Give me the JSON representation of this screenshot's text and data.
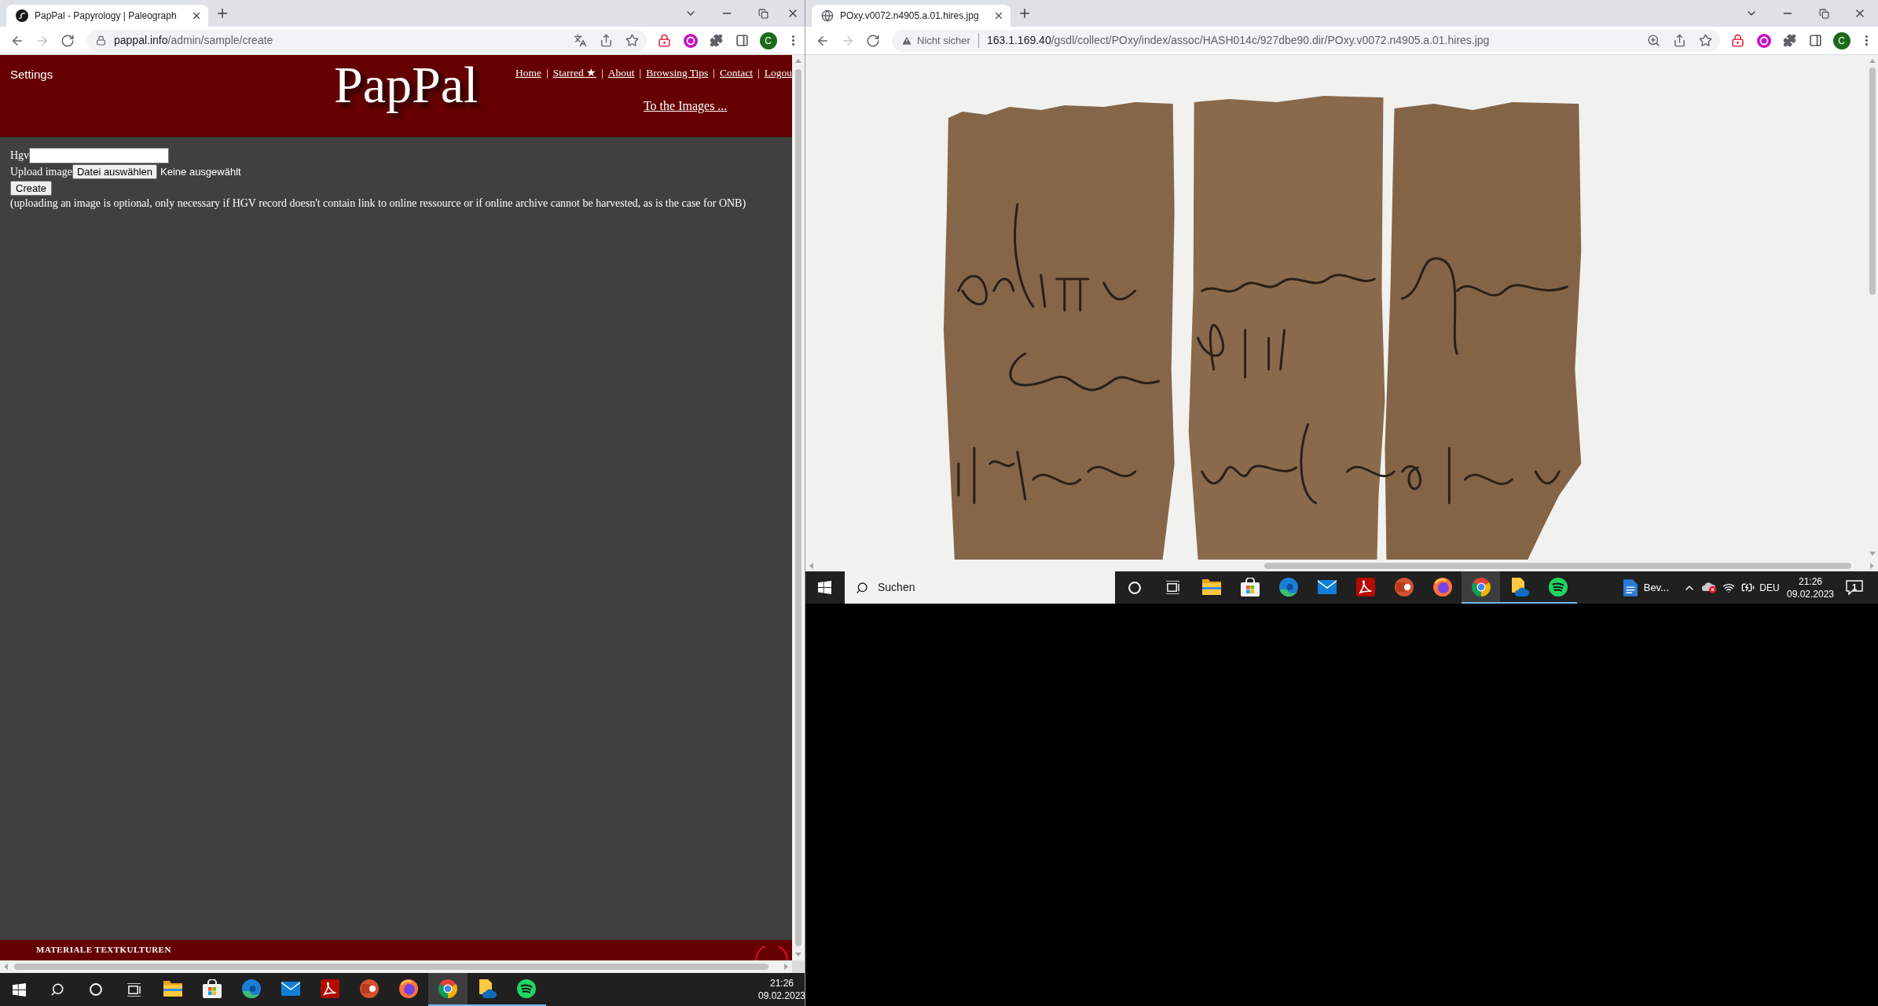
{
  "left_window": {
    "tab": {
      "title": "PapPal - Papyrology | Paleograph",
      "selected": true
    },
    "toolbar": {
      "back": {
        "disabled": false
      },
      "forward": {
        "disabled": true
      },
      "security": {
        "kind": "secure"
      },
      "url_host": "pappal.info",
      "url_path": "/admin/sample/create",
      "page_actions": [
        {
          "kind": "translate"
        },
        {
          "kind": "share"
        },
        {
          "kind": "bookmark"
        }
      ],
      "profile_initial": "C"
    },
    "page": {
      "header": {
        "settings": "Settings",
        "logo": "PapPal",
        "nav": [
          {
            "label": "Home",
            "separator": "|"
          },
          {
            "label": "Starred ★",
            "separator": "|"
          },
          {
            "label": "About",
            "separator": "|"
          },
          {
            "label": "Browsing Tips",
            "separator": "|"
          },
          {
            "label": "Contact",
            "separator": "|"
          },
          {
            "label": "Logou"
          }
        ],
        "images_link": "To the Images ..."
      },
      "form": {
        "hgv_label": "Hgv",
        "upload_label": "Upload image",
        "file_button": "Datei auswählen",
        "file_status": "Keine ausgewählt",
        "create_button": "Create",
        "note": "(uploading an image is optional, only necessary if HGV record doesn't contain link to online ressource or if online archive cannot be harvested, as is the case for ONB)"
      },
      "footer": {
        "title": "MATERIALE TEXTKULTUREN"
      }
    },
    "taskbar": {
      "search": {
        "kind": "button"
      },
      "apps": [
        {
          "kind": "explorer",
          "selected": false,
          "running": false
        },
        {
          "kind": "store",
          "selected": false,
          "running": false
        },
        {
          "kind": "edge",
          "selected": false,
          "running": false
        },
        {
          "kind": "mail",
          "selected": false,
          "running": false
        },
        {
          "kind": "pdf",
          "selected": false,
          "running": false
        },
        {
          "kind": "slides",
          "selected": false,
          "running": false
        },
        {
          "kind": "firefox",
          "selected": false,
          "running": false
        },
        {
          "kind": "chrome",
          "selected": true,
          "running": true
        },
        {
          "kind": "clouddrive",
          "selected": false,
          "running": true
        },
        {
          "kind": "spotify",
          "selected": false,
          "running": true
        }
      ],
      "clock": {
        "time": "21:26",
        "date": "09.02.2023"
      }
    }
  },
  "right_window": {
    "tab": {
      "title": "POxy.v0072.n4905.a.01.hires.jpg",
      "selected": true
    },
    "toolbar": {
      "back": {
        "disabled": false
      },
      "forward": {
        "disabled": true
      },
      "security": {
        "kind": "insecure",
        "label": "Nicht sicher"
      },
      "url_host": "163.1.169.40",
      "url_path": "/gsdl/collect/POxy/index/assoc/HASH014c/927dbe90.dir/POxy.v0072.n4905.a.01.hires.jpg",
      "page_actions": [
        {
          "kind": "zoom"
        },
        {
          "kind": "share"
        },
        {
          "kind": "bookmark"
        }
      ],
      "profile_initial": "C"
    },
    "taskbar": {
      "search": {
        "kind": "box",
        "placeholder": "Suchen"
      },
      "apps": [
        {
          "kind": "explorer",
          "selected": false,
          "running": false
        },
        {
          "kind": "store",
          "selected": false,
          "running": false
        },
        {
          "kind": "edge",
          "selected": false,
          "running": false
        },
        {
          "kind": "mail",
          "selected": false,
          "running": false
        },
        {
          "kind": "pdf",
          "selected": false,
          "running": false
        },
        {
          "kind": "slides",
          "selected": false,
          "running": false
        },
        {
          "kind": "firefox",
          "selected": false,
          "running": false
        },
        {
          "kind": "chrome",
          "selected": true,
          "running": true
        },
        {
          "kind": "clouddrive",
          "selected": false,
          "running": true
        },
        {
          "kind": "spotify",
          "selected": false,
          "running": true
        }
      ],
      "windows": [
        {
          "label": "Bev..."
        }
      ],
      "tray": {
        "language": "DEU",
        "notifications": "1"
      },
      "clock": {
        "time": "21:26",
        "date": "09.02.2023"
      }
    }
  }
}
